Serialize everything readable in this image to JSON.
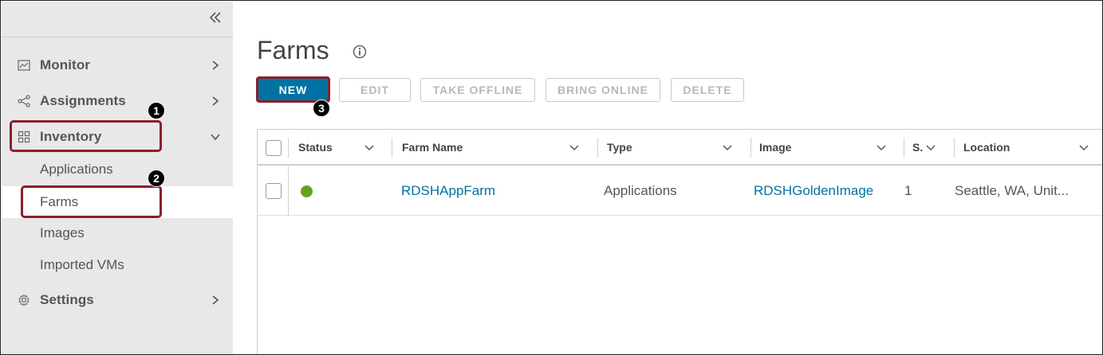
{
  "sidebar": {
    "items": [
      {
        "label": "Monitor",
        "icon": "chart-icon"
      },
      {
        "label": "Assignments",
        "icon": "share-icon"
      },
      {
        "label": "Inventory",
        "icon": "grid-icon"
      },
      {
        "label": "Settings",
        "icon": "gear-icon"
      }
    ],
    "inventory_children": [
      {
        "label": "Applications"
      },
      {
        "label": "Farms"
      },
      {
        "label": "Images"
      },
      {
        "label": "Imported VMs"
      }
    ],
    "active_child": "Farms"
  },
  "page": {
    "title": "Farms"
  },
  "toolbar": {
    "new_label": "NEW",
    "edit_label": "EDIT",
    "take_offline_label": "TAKE OFFLINE",
    "bring_online_label": "BRING ONLINE",
    "delete_label": "DELETE"
  },
  "callouts": {
    "one": "1",
    "two": "2",
    "three": "3"
  },
  "grid": {
    "columns": [
      "Status",
      "Farm Name",
      "Type",
      "Image",
      "S.",
      "Location"
    ],
    "rows": [
      {
        "status": "online",
        "farm_name": "RDSHAppFarm",
        "type": "Applications",
        "image": "RDSHGoldenImage",
        "sessions": "1",
        "location": "Seattle, WA, Unit..."
      }
    ]
  },
  "colors": {
    "accent": "#0072a3",
    "callout": "#8b1f2a",
    "status_online": "#62a420",
    "sidebar_bg": "#e8e8e8"
  }
}
